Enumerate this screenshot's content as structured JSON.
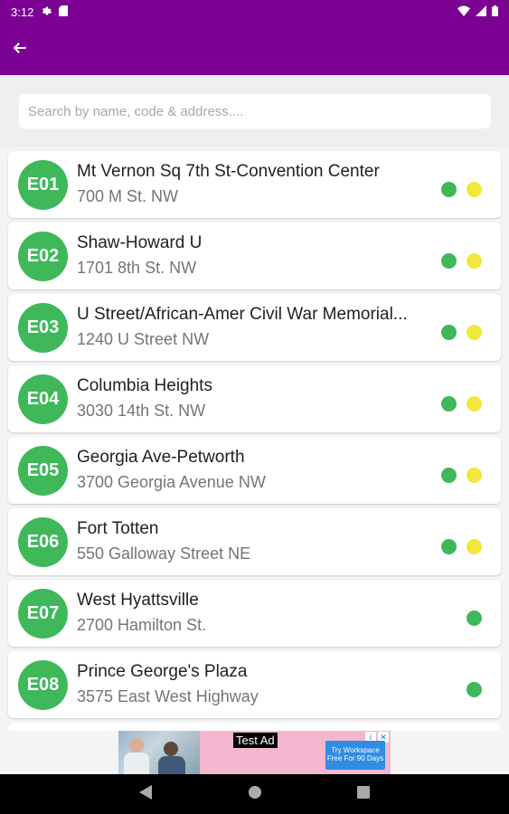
{
  "status_bar": {
    "time": "3:12",
    "icons": [
      "gear-icon",
      "sd-card-icon",
      "wifi-icon",
      "signal-icon",
      "battery-icon"
    ]
  },
  "app_bar": {
    "back_icon": "arrow-left-icon",
    "color": "#7b0293"
  },
  "search": {
    "placeholder": "Search by name, code & address....",
    "value": ""
  },
  "colors": {
    "badge_green": "#3fb85a",
    "line_green": "#3fb85a",
    "line_yellow": "#f2e83a"
  },
  "stations": [
    {
      "code": "E01",
      "name": "Mt Vernon Sq 7th St-Convention Center",
      "address": "700 M St. NW",
      "lines": [
        "green",
        "yellow"
      ]
    },
    {
      "code": "E02",
      "name": "Shaw-Howard U",
      "address": "1701 8th St. NW",
      "lines": [
        "green",
        "yellow"
      ]
    },
    {
      "code": "E03",
      "name": "U Street/African-Amer Civil War Memorial...",
      "address": "1240 U Street NW",
      "lines": [
        "green",
        "yellow"
      ]
    },
    {
      "code": "E04",
      "name": "Columbia Heights",
      "address": "3030 14th St. NW",
      "lines": [
        "green",
        "yellow"
      ]
    },
    {
      "code": "E05",
      "name": "Georgia Ave-Petworth",
      "address": "3700 Georgia Avenue NW",
      "lines": [
        "green",
        "yellow"
      ]
    },
    {
      "code": "E06",
      "name": "Fort Totten",
      "address": "550 Galloway Street NE",
      "lines": [
        "green",
        "yellow"
      ]
    },
    {
      "code": "E07",
      "name": "West Hyattsville",
      "address": "2700 Hamilton St.",
      "lines": [
        "green"
      ]
    },
    {
      "code": "E08",
      "name": "Prince George's Plaza",
      "address": "3575 East West Highway",
      "lines": [
        "green"
      ]
    }
  ],
  "ad": {
    "label": "Test Ad",
    "cta": "Try Workspace Free For 90 Days"
  },
  "nav_bar": {
    "icons": [
      "back-triangle-icon",
      "home-circle-icon",
      "recents-square-icon"
    ]
  }
}
